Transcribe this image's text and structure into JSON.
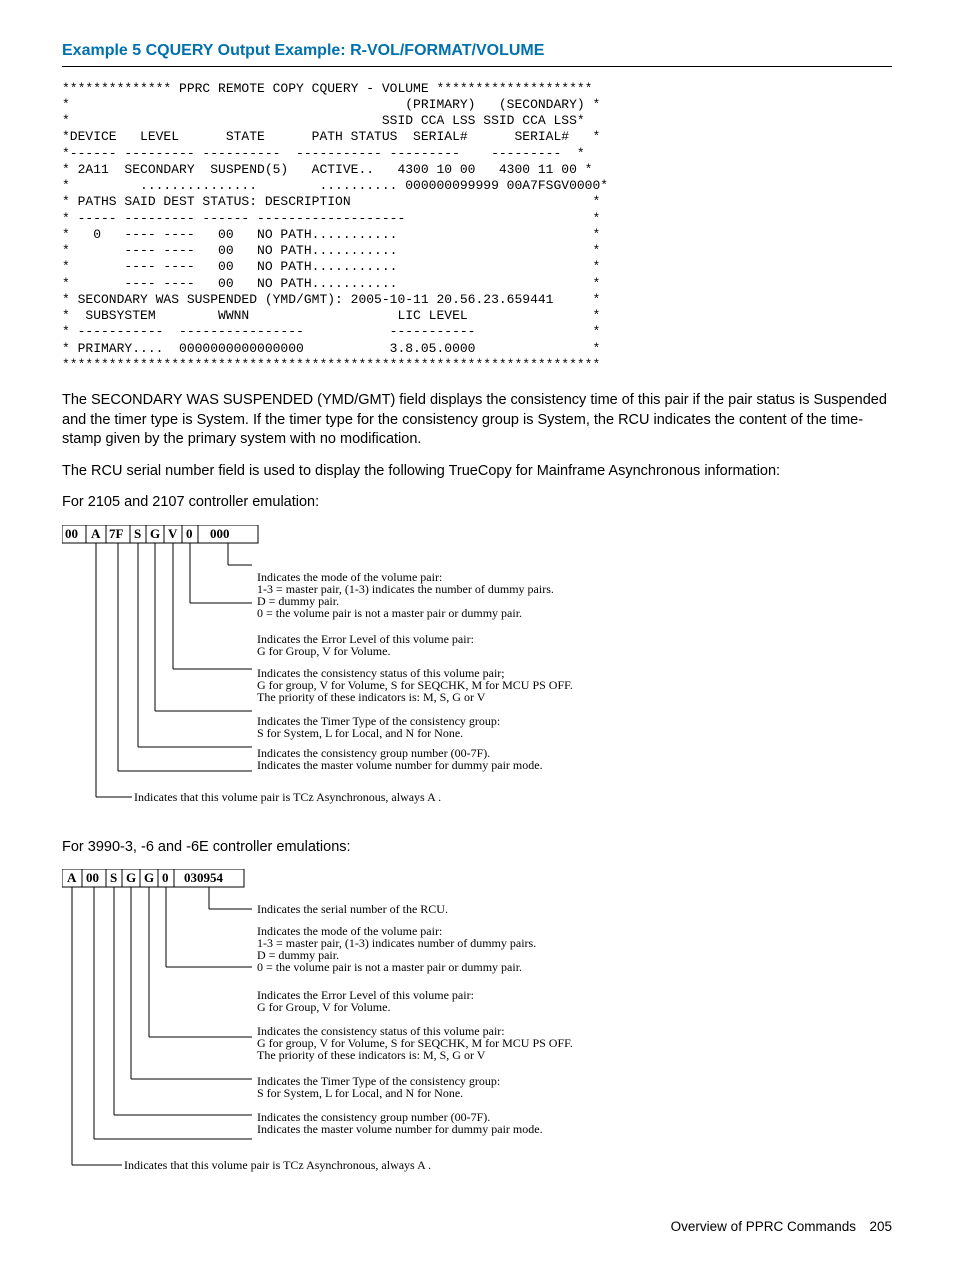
{
  "title": "Example 5 CQUERY Output Example: R-VOL/FORMAT/VOLUME",
  "terminal": "************** PPRC REMOTE COPY CQUERY - VOLUME ********************\n*                                           (PRIMARY)   (SECONDARY) *\n*                                        SSID CCA LSS SSID CCA LSS*\n*DEVICE   LEVEL      STATE      PATH STATUS  SERIAL#      SERIAL#   *\n*------ --------- ----------  ----------- ---------    ---------  *\n* 2A11  SECONDARY  SUSPEND(5)   ACTIVE..   4300 10 00   4300 11 00 *\n*         ...............        .......... 000000099999 00A7FSGV0000*\n* PATHS SAID DEST STATUS: DESCRIPTION                               *\n* ----- --------- ------ -------------------                        *\n*   0   ---- ----   00   NO PATH...........                         *\n*       ---- ----   00   NO PATH...........                         *\n*       ---- ----   00   NO PATH...........                         *\n*       ---- ----   00   NO PATH...........                         *\n* SECONDARY WAS SUSPENDED (YMD/GMT): 2005-10-11 20.56.23.659441     *\n*  SUBSYSTEM        WWNN                   LIC LEVEL                *\n* -----------  ----------------           -----------               *\n* PRIMARY....  0000000000000000           3.8.05.0000               *\n*********************************************************************",
  "para1": "The SECONDARY WAS SUSPENDED (YMD/GMT) field displays the consistency time of this pair if the pair status is Suspended and the timer type is System. If the timer type for the consistency group is System, the RCU indicates the content of the time-stamp given by the primary system with no modification.",
  "para2": "The RCU serial number field is used to display the following TrueCopy for Mainframe Asynchronous information:",
  "para3": "For 2105 and 2107 controller emulation:",
  "para4": "For 3990-3, -6 and -6E controller emulations:",
  "diag1": {
    "cells": [
      "00",
      "A",
      "7F",
      "S",
      "G",
      "V",
      "0",
      "000"
    ],
    "lines": [
      "Indicates the mode of the volume pair:",
      "1-3 = master pair, (1-3) indicates the number of dummy pairs.",
      "D = dummy pair.",
      "0 = the volume pair is not a master pair or dummy pair.",
      "Indicates the Error Level of this volume pair:",
      "G for Group, V for Volume.",
      "Indicates the consistency status of this volume pair;",
      "G for group, V for Volume, S for SEQCHK, M for MCU PS OFF.",
      "The priority of these indicators is: M, S, G or V",
      "Indicates the Timer Type of the consistency group:",
      "S for System, L for Local, and N for None.",
      "Indicates the consistency group number (00-7F).",
      "Indicates the master volume number for dummy pair mode.",
      "Indicates that this volume pair is TCz Asynchronous, always A ."
    ]
  },
  "diag2": {
    "cells": [
      "A",
      "00",
      "S",
      "G",
      "G",
      "0",
      "030954"
    ],
    "lines": [
      "Indicates the serial number of the RCU.",
      "Indicates the mode of the volume pair:",
      "1-3 = master pair, (1-3) indicates number of dummy pairs.",
      "D = dummy pair.",
      "0 = the volume pair is not a master pair or dummy pair.",
      "Indicates the Error Level of this volume pair:",
      "G for Group, V for Volume.",
      "Indicates the consistency status of this volume pair:",
      "G for group, V for Volume, S for SEQCHK, M for MCU PS OFF.",
      "The priority of these indicators is: M, S, G or V",
      "Indicates the Timer Type of the consistency group:",
      "S for System, L for Local, and N for None.",
      "Indicates the consistency group number (00-7F).",
      "Indicates the master volume number for dummy pair mode.",
      "Indicates that this volume pair is TCz Asynchronous, always A ."
    ]
  },
  "footer": "Overview of PPRC Commands 205"
}
